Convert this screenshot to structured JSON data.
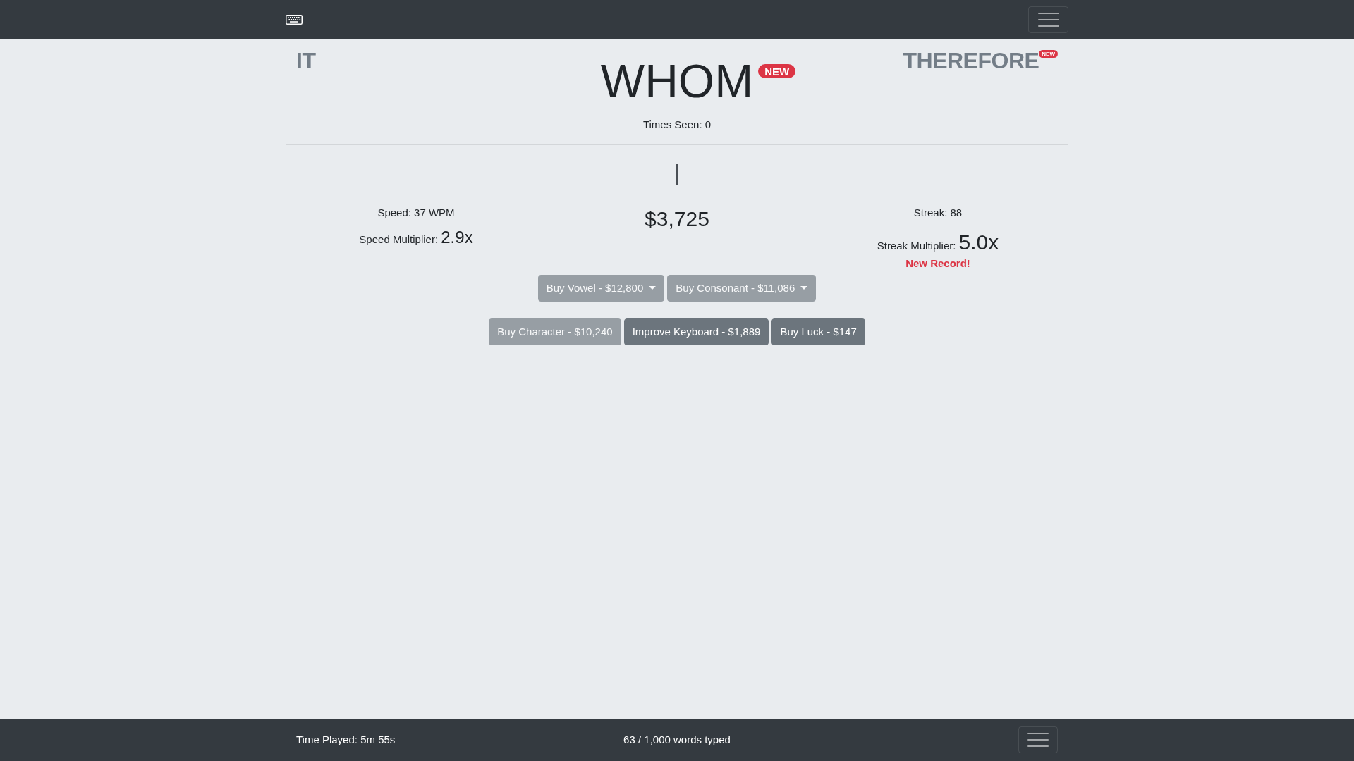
{
  "word_queue": {
    "previous_word": {
      "text": "IT"
    },
    "current_word": {
      "text": "WHOM",
      "badge": "NEW",
      "times_seen": "Times Seen: 0"
    },
    "next_word": {
      "text": "THEREFORE",
      "badge": "NEW"
    }
  },
  "stats": {
    "speed": "Speed: 37 WPM",
    "speed_multiplier": {
      "label": "Speed Multiplier:",
      "value": "2.9x"
    },
    "money": "$3,725",
    "streak": "Streak: 88",
    "streak_multiplier": {
      "label": "Streak Multiplier:",
      "value": "5.0x"
    },
    "record_note": "New Record!"
  },
  "shop_rows": [
    [
      {
        "label": "Buy Vowel - $12,800",
        "kind": "dropdown",
        "disabled": true
      },
      {
        "label": "Buy Consonant - $11,086",
        "kind": "dropdown",
        "disabled": true
      }
    ],
    [
      {
        "label": "Buy Character - $10,240",
        "kind": "button",
        "disabled": true
      },
      {
        "label": "Improve Keyboard - $1,889",
        "kind": "button",
        "disabled": false
      },
      {
        "label": "Buy Luck - $147",
        "kind": "button",
        "disabled": false
      }
    ]
  ],
  "footer": {
    "time_played": "Time Played: 5m 55s",
    "words_typed": "63 / 1,000 words typed"
  }
}
